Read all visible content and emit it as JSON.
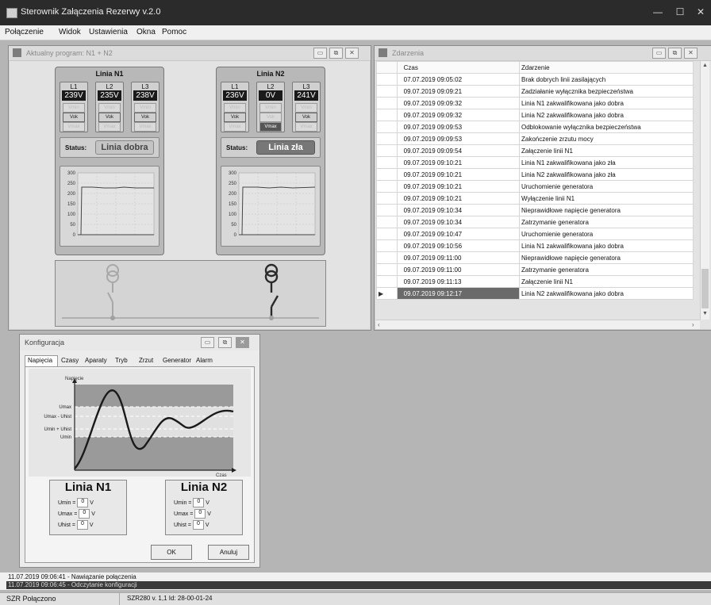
{
  "app": {
    "title": "Sterownik Załączenia Rezerwy v.2.0"
  },
  "menu": [
    "Połączenie",
    "Widok",
    "Ustawienia",
    "Okna",
    "Pomoc"
  ],
  "program_window": {
    "title": "Aktualny program: N1 + N2",
    "lines": [
      {
        "title": "Linia N1",
        "phases": [
          {
            "name": "L1",
            "value": "239V",
            "inds": [
              "Vmin",
              "Vok",
              "Vmax"
            ],
            "active": 1
          },
          {
            "name": "L2",
            "value": "235V",
            "inds": [
              "Vmin",
              "Vok",
              "Vmax"
            ],
            "active": 1
          },
          {
            "name": "L3",
            "value": "238V",
            "inds": [
              "Vmin",
              "Vok",
              "Vmax"
            ],
            "active": 1
          }
        ],
        "status_label": "Status:",
        "status": "Linia dobra",
        "y_ticks": [
          "300",
          "250",
          "200",
          "150",
          "100",
          "50",
          "0"
        ]
      },
      {
        "title": "Linia N2",
        "phases": [
          {
            "name": "L1",
            "value": "236V",
            "inds": [
              "Vmin",
              "Vok",
              "Vmax"
            ],
            "active": 1
          },
          {
            "name": "L2",
            "value": "0V",
            "inds": [
              "Vmin",
              "Vok",
              "Vmax"
            ],
            "active": 2
          },
          {
            "name": "L3",
            "value": "241V",
            "inds": [
              "Vmin",
              "Vok",
              "Vmax"
            ],
            "active": 1
          }
        ],
        "status_label": "Status:",
        "status": "Linia zła",
        "y_ticks": [
          "300",
          "250",
          "200",
          "150",
          "100",
          "50",
          "0"
        ]
      }
    ]
  },
  "events_window": {
    "title": "Zdarzenia",
    "columns": [
      "Czas",
      "Zdarzenie"
    ],
    "rows": [
      [
        "07.07.2019 09:05:02",
        "Brak dobrych linii zasilających"
      ],
      [
        "09.07.2019 09:09:21",
        "Zadziałanie wyłącznika bezpieczeństwa"
      ],
      [
        "09.07.2019 09:09:32",
        "Linia N1 zakwalifikowana jako dobra"
      ],
      [
        "09.07.2019 09:09:32",
        "Linia N2 zakwalifikowana jako dobra"
      ],
      [
        "09.07.2019 09:09:53",
        "Odblokowanie wyłącznika bezpieczeństwa"
      ],
      [
        "09.07.2019 09:09:53",
        "Zakończenie zrzutu mocy"
      ],
      [
        "09.07.2019 09:09:54",
        "Załączenie linii N1"
      ],
      [
        "09.07.2019 09:10:21",
        "Linia N1 zakwalifikowana jako zła"
      ],
      [
        "09.07.2019 09:10:21",
        "Linia N2 zakwalifikowana jako zła"
      ],
      [
        "09.07.2019 09:10:21",
        "Uruchomienie generatora"
      ],
      [
        "09.07.2019 09:10:21",
        "Wyłączenie linii N1"
      ],
      [
        "09.07.2019 09:10:34",
        "Nieprawidłowe napięcie generatora"
      ],
      [
        "09.07.2019 09:10:34",
        "Zatrzymanie generatora"
      ],
      [
        "09.07.2019 09:10:47",
        "Uruchomienie generatora"
      ],
      [
        "09.07.2019 09:10:56",
        "Linia N1 zakwalifikowana jako dobra"
      ],
      [
        "09.07.2019 09:11:00",
        "Nieprawidłowe napięcie generatora"
      ],
      [
        "09.07.2019 09:11:00",
        "Zatrzymanie generatora"
      ],
      [
        "09.07.2019 09:11:13",
        "Załączenie linii N1"
      ],
      [
        "09.07.2019 09:12:17",
        "Linia N2 zakwalifikowana jako dobra"
      ]
    ],
    "selected_row": 18
  },
  "config_window": {
    "title": "Konfiguracja",
    "tabs": [
      "Napięcia",
      "Czasy",
      "Aparaty",
      "Tryb",
      "Zrzut",
      "Generator",
      "Alarm"
    ],
    "active_tab": "Napięcia",
    "diagram": {
      "y_axis": "Napięcie",
      "x_axis": "Czas",
      "levels": [
        "Umax",
        "Umax - Uhist",
        "Umin + Uhist",
        "Umin"
      ]
    },
    "line_n1": {
      "title": "Linia N1",
      "fields": [
        {
          "label": "Umin =",
          "value": "0",
          "unit": "V"
        },
        {
          "label": "Umax =",
          "value": "0",
          "unit": "V"
        },
        {
          "label": "Uhist =",
          "value": "0",
          "unit": "V"
        }
      ]
    },
    "line_n2": {
      "title": "Linia N2",
      "fields": [
        {
          "label": "Umin =",
          "value": "0",
          "unit": "V"
        },
        {
          "label": "Umax =",
          "value": "0",
          "unit": "V"
        },
        {
          "label": "Uhist =",
          "value": "0",
          "unit": "V"
        }
      ]
    },
    "ok": "OK",
    "cancel": "Anuluj"
  },
  "log": [
    "11.07.2019 09:06:41 - Nawiązanie połączenia",
    "11.07.2019 09:06:45 - Odczytanie konfiguracji"
  ],
  "statusbar": {
    "connection": "SZR Połączono",
    "version": "SZR280 v. 1,1 Id: 28-00-01-24"
  }
}
